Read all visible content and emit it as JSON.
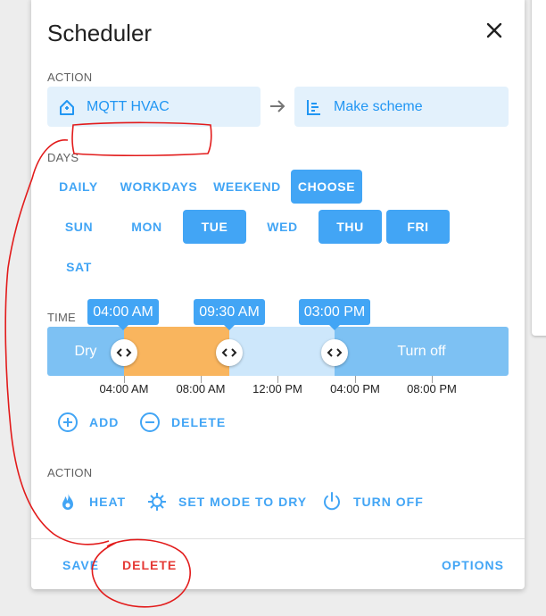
{
  "dialog": {
    "title": "Scheduler"
  },
  "action_top": {
    "label": "ACTION",
    "entity": "MQTT HVAC",
    "service": "Make scheme"
  },
  "days": {
    "label": "DAYS",
    "modes": [
      {
        "label": "DAILY",
        "active": false
      },
      {
        "label": "WORKDAYS",
        "active": false
      },
      {
        "label": "WEEKEND",
        "active": false
      },
      {
        "label": "CHOOSE",
        "active": true
      }
    ],
    "weekdays": [
      {
        "label": "SUN",
        "active": false
      },
      {
        "label": "MON",
        "active": false
      },
      {
        "label": "TUE",
        "active": true
      },
      {
        "label": "WED",
        "active": false
      },
      {
        "label": "THU",
        "active": true
      },
      {
        "label": "FRI",
        "active": true
      },
      {
        "label": "SAT",
        "active": false
      }
    ]
  },
  "time": {
    "label": "TIME",
    "markers": [
      "04:00 AM",
      "09:30 AM",
      "03:00 PM"
    ],
    "segments": [
      {
        "label": "Dry",
        "color": "#7dc1f3"
      },
      {
        "label": "",
        "color": "#f9b55e"
      },
      {
        "label": "",
        "color": "#cde7fb"
      },
      {
        "label": "Turn off",
        "color": "#7dc1f3"
      }
    ],
    "ticks": [
      "04:00 AM",
      "08:00 AM",
      "12:00 PM",
      "04:00 PM",
      "08:00 PM"
    ],
    "add_label": "ADD",
    "delete_label": "DELETE"
  },
  "action_bottom": {
    "label": "ACTION",
    "options": [
      {
        "label": "HEAT",
        "icon": "fire-icon"
      },
      {
        "label": "SET MODE TO DRY",
        "icon": "gear-sync-icon"
      },
      {
        "label": "TURN OFF",
        "icon": "power-icon"
      }
    ]
  },
  "footer": {
    "save_label": "SAVE",
    "delete_label": "DELETE",
    "options_label": "OPTIONS"
  },
  "colors": {
    "accent": "#42a5f5",
    "chip_bg": "#e3f1fc",
    "delete_red": "#e53935",
    "annotation_red": "#e21b1b"
  }
}
